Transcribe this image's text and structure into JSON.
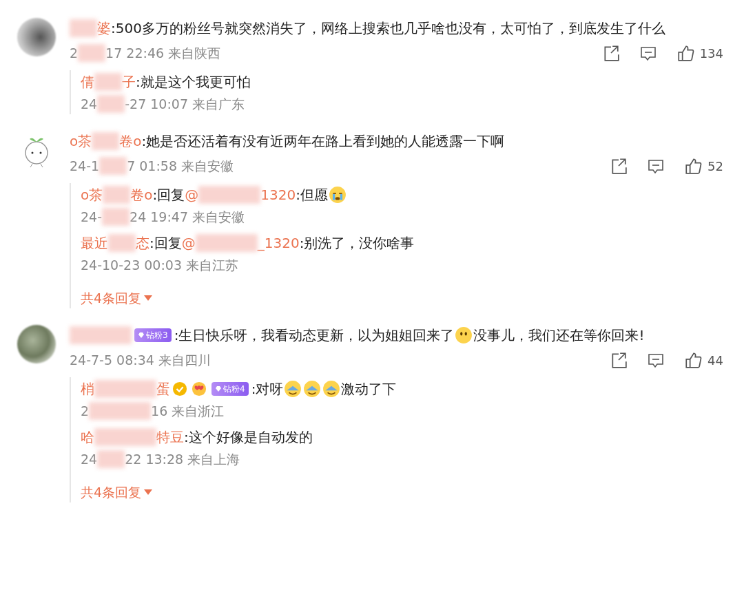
{
  "comments": [
    {
      "avatar": {
        "kind": "blurred"
      },
      "line": [
        {
          "kind": "blur-short"
        },
        {
          "kind": "name",
          "text": "婆"
        },
        {
          "kind": "text",
          "text": ":500多万的粉丝号就突然消失了，网络上搜索也几乎啥也没有，太可怕了，到底发生了什么"
        }
      ],
      "meta": [
        {
          "kind": "text",
          "text": "2"
        },
        {
          "kind": "blur-short"
        },
        {
          "kind": "text",
          "text": "17 22:46 来自陕西"
        }
      ],
      "likes": "134",
      "replies": [
        {
          "line": [
            {
              "kind": "name",
              "text": "倩"
            },
            {
              "kind": "blur-short"
            },
            {
              "kind": "name",
              "text": "子"
            },
            {
              "kind": "text",
              "text": ":就是这个我更可怕"
            }
          ],
          "meta": [
            {
              "kind": "text",
              "text": "24"
            },
            {
              "kind": "blur-short"
            },
            {
              "kind": "text",
              "text": "-27 10:07 来自广东"
            }
          ]
        }
      ]
    },
    {
      "avatar": {
        "kind": "sprout"
      },
      "line": [
        {
          "kind": "name",
          "text": "o茶"
        },
        {
          "kind": "blur-short"
        },
        {
          "kind": "name",
          "text": "卷o"
        },
        {
          "kind": "text",
          "text": ":她是否还活着有没有近两年在路上看到她的人能透露一下啊"
        }
      ],
      "meta": [
        {
          "kind": "text",
          "text": "24-1"
        },
        {
          "kind": "blur-short"
        },
        {
          "kind": "text",
          "text": "7 01:58 来自安徽"
        }
      ],
      "likes": "52",
      "replies": [
        {
          "line": [
            {
              "kind": "name",
              "text": "o茶"
            },
            {
              "kind": "blur-short"
            },
            {
              "kind": "name",
              "text": "卷o"
            },
            {
              "kind": "text",
              "text": ":回复"
            },
            {
              "kind": "name",
              "text": "@"
            },
            {
              "kind": "blur-long"
            },
            {
              "kind": "name",
              "text": "1320"
            },
            {
              "kind": "text",
              "text": ":但愿"
            },
            {
              "kind": "emoji-crying"
            }
          ],
          "meta": [
            {
              "kind": "text",
              "text": "24-"
            },
            {
              "kind": "blur-short"
            },
            {
              "kind": "text",
              "text": "24 19:47 来自安徽"
            }
          ]
        },
        {
          "line": [
            {
              "kind": "name",
              "text": "最近"
            },
            {
              "kind": "blur-short"
            },
            {
              "kind": "name",
              "text": "态"
            },
            {
              "kind": "text",
              "text": ":回复"
            },
            {
              "kind": "name",
              "text": "@"
            },
            {
              "kind": "blur-long"
            },
            {
              "kind": "name",
              "text": "_1320"
            },
            {
              "kind": "text",
              "text": ":别洗了，没你啥事"
            }
          ],
          "meta": [
            {
              "kind": "text",
              "text": "24-10-23 00:03 来自江苏"
            }
          ]
        }
      ],
      "more": "共4条回复"
    },
    {
      "avatar": {
        "kind": "blurred-green"
      },
      "line": [
        {
          "kind": "blur-long"
        },
        {
          "kind": "badge",
          "text": "钻粉3"
        },
        {
          "kind": "text",
          "text": ":生日快乐呀，我看动态更新，以为姐姐回来了"
        },
        {
          "kind": "emoji-smile"
        },
        {
          "kind": "text",
          "text": "没事儿，我们还在等你回来!"
        }
      ],
      "meta": [
        {
          "kind": "text",
          "text": "24-7-5 08:34 来自四川"
        }
      ],
      "likes": "44",
      "replies": [
        {
          "line": [
            {
              "kind": "name",
              "text": "梢"
            },
            {
              "kind": "blur-long"
            },
            {
              "kind": "name",
              "text": "蛋"
            },
            {
              "kind": "verified"
            },
            {
              "kind": "heart"
            },
            {
              "kind": "badge",
              "text": "钻粉4"
            },
            {
              "kind": "text",
              "text": ":对呀"
            },
            {
              "kind": "emoji-laughing"
            },
            {
              "kind": "emoji-laughing"
            },
            {
              "kind": "emoji-laughing"
            },
            {
              "kind": "text",
              "text": "激动了下"
            }
          ],
          "meta": [
            {
              "kind": "text",
              "text": "2"
            },
            {
              "kind": "blur-long"
            },
            {
              "kind": "text",
              "text": "16 来自浙江"
            }
          ]
        },
        {
          "line": [
            {
              "kind": "name",
              "text": "哈"
            },
            {
              "kind": "blur-long"
            },
            {
              "kind": "name",
              "text": "特豆"
            },
            {
              "kind": "text",
              "text": ":这个好像是自动发的"
            }
          ],
          "meta": [
            {
              "kind": "text",
              "text": "24"
            },
            {
              "kind": "blur-short"
            },
            {
              "kind": "text",
              "text": "22 13:28 来自上海"
            }
          ]
        }
      ],
      "more": "共4条回复"
    }
  ]
}
